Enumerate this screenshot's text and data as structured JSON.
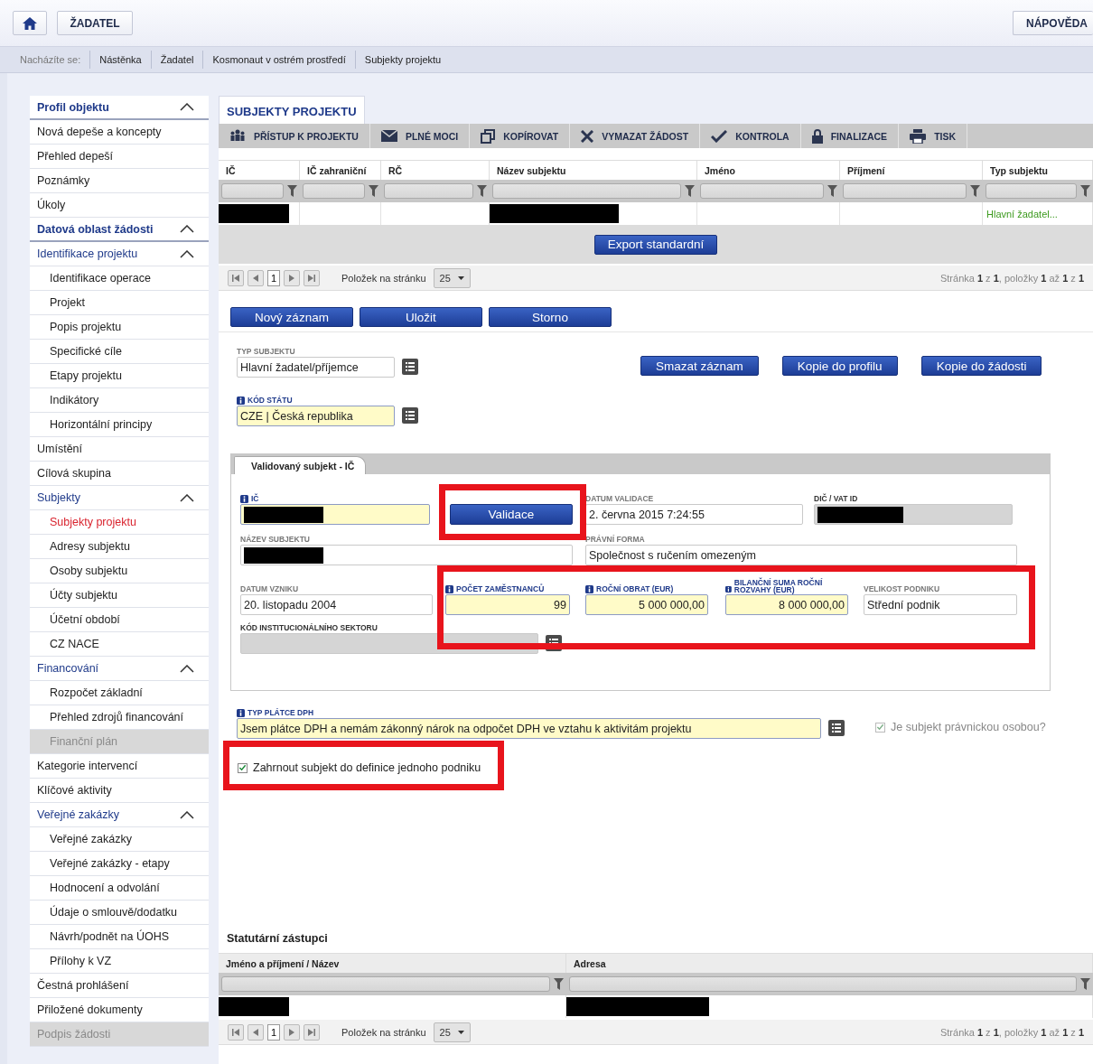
{
  "header": {
    "app_button": "ŽADATEL",
    "help_button": "NÁPOVĚDA"
  },
  "breadcrumb": {
    "prefix": "Nacházíte se:",
    "items": [
      "Nástěnka",
      "Žadatel",
      "Kosmonaut v ostrém prostředí",
      "Subjekty projektu"
    ]
  },
  "sidebar": {
    "items": [
      {
        "label": "Profil objektu",
        "kind": "section",
        "expanded": true,
        "selected": false,
        "disabled": false,
        "children": [
          {
            "label": "Nová depeše a koncepty",
            "kind": "item",
            "selected": false,
            "disabled": false
          },
          {
            "label": "Přehled depeší",
            "kind": "item",
            "selected": false,
            "disabled": false
          },
          {
            "label": "Poznámky",
            "kind": "item",
            "selected": false,
            "disabled": false
          },
          {
            "label": "Úkoly",
            "kind": "item",
            "selected": false,
            "disabled": false
          }
        ]
      },
      {
        "label": "Datová oblast žádosti",
        "kind": "section",
        "expanded": true,
        "selected": false,
        "disabled": false,
        "children": [
          {
            "label": "Identifikace projektu",
            "kind": "group",
            "expanded": true,
            "selected": false,
            "disabled": false,
            "children": [
              {
                "label": "Identifikace operace",
                "kind": "item",
                "selected": false,
                "disabled": false
              },
              {
                "label": "Projekt",
                "kind": "item",
                "selected": false,
                "disabled": false
              },
              {
                "label": "Popis projektu",
                "kind": "item",
                "selected": false,
                "disabled": false
              },
              {
                "label": "Specifické cíle",
                "kind": "item",
                "selected": false,
                "disabled": false
              },
              {
                "label": "Etapy projektu",
                "kind": "item",
                "selected": false,
                "disabled": false
              },
              {
                "label": "Indikátory",
                "kind": "item",
                "selected": false,
                "disabled": false
              },
              {
                "label": "Horizontální principy",
                "kind": "item",
                "selected": false,
                "disabled": false
              }
            ]
          },
          {
            "label": "Umístění",
            "kind": "item",
            "selected": false,
            "disabled": false
          },
          {
            "label": "Cílová skupina",
            "kind": "item",
            "selected": false,
            "disabled": false
          },
          {
            "label": "Subjekty",
            "kind": "group",
            "expanded": true,
            "selected": false,
            "disabled": false,
            "children": [
              {
                "label": "Subjekty projektu",
                "kind": "item",
                "selected": true,
                "disabled": false
              },
              {
                "label": "Adresy subjektu",
                "kind": "item",
                "selected": false,
                "disabled": false
              },
              {
                "label": "Osoby subjektu",
                "kind": "item",
                "selected": false,
                "disabled": false
              },
              {
                "label": "Účty subjektu",
                "kind": "item",
                "selected": false,
                "disabled": false
              },
              {
                "label": "Účetní období",
                "kind": "item",
                "selected": false,
                "disabled": false
              },
              {
                "label": "CZ NACE",
                "kind": "item",
                "selected": false,
                "disabled": false
              }
            ]
          },
          {
            "label": "Financování",
            "kind": "group",
            "expanded": true,
            "selected": false,
            "disabled": false,
            "children": [
              {
                "label": "Rozpočet základní",
                "kind": "item",
                "selected": false,
                "disabled": false
              },
              {
                "label": "Přehled zdrojů financování",
                "kind": "item",
                "selected": false,
                "disabled": false
              },
              {
                "label": "Finanční plán",
                "kind": "item",
                "selected": false,
                "disabled": true
              }
            ]
          },
          {
            "label": "Kategorie intervencí",
            "kind": "item",
            "selected": false,
            "disabled": false
          },
          {
            "label": "Klíčové aktivity",
            "kind": "item",
            "selected": false,
            "disabled": false
          },
          {
            "label": "Veřejné zakázky",
            "kind": "group",
            "expanded": true,
            "selected": false,
            "disabled": false,
            "children": [
              {
                "label": "Veřejné zakázky",
                "kind": "item",
                "selected": false,
                "disabled": false
              },
              {
                "label": "Veřejné zakázky - etapy",
                "kind": "item",
                "selected": false,
                "disabled": false
              },
              {
                "label": "Hodnocení a odvolání",
                "kind": "item",
                "selected": false,
                "disabled": false
              },
              {
                "label": "Údaje o smlouvě/dodatku",
                "kind": "item",
                "selected": false,
                "disabled": false
              },
              {
                "label": "Návrh/podnět na ÚOHS",
                "kind": "item",
                "selected": false,
                "disabled": false
              },
              {
                "label": "Přílohy k VZ",
                "kind": "item",
                "selected": false,
                "disabled": false
              }
            ]
          },
          {
            "label": "Čestná prohlášení",
            "kind": "item",
            "selected": false,
            "disabled": false
          },
          {
            "label": "Přiložené dokumenty",
            "kind": "item",
            "selected": false,
            "disabled": false
          },
          {
            "label": "Podpis žádosti",
            "kind": "item",
            "selected": false,
            "disabled": true
          }
        ]
      }
    ]
  },
  "tab": {
    "label": "SUBJEKTY PROJEKTU",
    "selected": true
  },
  "toolbar": [
    {
      "label": "PŘÍSTUP K PROJEKTU",
      "kind": "people"
    },
    {
      "label": "PLNÉ MOCI",
      "kind": "mail"
    },
    {
      "label": "KOPÍROVAT",
      "kind": "copy"
    },
    {
      "label": "VYMAZAT ŽÁDOST",
      "kind": "delete"
    },
    {
      "label": "KONTROLA",
      "kind": "check"
    },
    {
      "label": "FINALIZACE",
      "kind": "lock"
    },
    {
      "label": "TISK",
      "kind": "print"
    }
  ],
  "subjects_table": {
    "columns": [
      "IČ",
      "IČ zahraniční",
      "RČ",
      "Název subjektu",
      "Jméno",
      "Příjmení",
      "Typ subjektu"
    ],
    "rows": [
      {
        "cells": [
          {
            "kind": "redacted"
          },
          {
            "kind": "empty"
          },
          {
            "kind": "empty"
          },
          {
            "kind": "redacted"
          },
          {
            "kind": "empty"
          },
          {
            "kind": "empty"
          },
          {
            "kind": "text",
            "text": "Hlavní žadatel..."
          }
        ]
      }
    ],
    "export_button": "Export standardní",
    "pager": {
      "page": "1",
      "page_size_label": "Položek na stránku",
      "page_size": "25",
      "summary": "Stránka **1** z **1**, položky **1** až **1** z **1**"
    }
  },
  "form_buttons": [
    "Nový záznam",
    "Uložit",
    "Storno"
  ],
  "subject_type": {
    "label": "TYP SUBJEKTU",
    "value": "Hlavní žadatel/příjemce",
    "required": false,
    "info": false
  },
  "record_buttons": [
    "Smazat záznam",
    "Kopie do profilu",
    "Kopie do žádosti"
  ],
  "country": {
    "label": "KÓD STÁTU",
    "value": "CZE | Česká republika",
    "required": true,
    "info": true
  },
  "validated_panel": {
    "tab": {
      "label": "Validovaný subjekt - IČ",
      "selected": true
    },
    "fields": [
      {
        "kind": "field",
        "label": "IČ",
        "required": true,
        "readonly": false,
        "info": true,
        "redacted": true
      },
      {
        "kind": "button",
        "label": "Validace"
      },
      {
        "kind": "field",
        "label": "DATUM VALIDACE",
        "value": "2. června 2015 7:24:55",
        "required": false,
        "readonly": false,
        "info": false,
        "redacted": false
      },
      {
        "kind": "field",
        "label": "DIČ / VAT ID",
        "required": false,
        "readonly": true,
        "info": false,
        "redacted": true
      },
      {
        "kind": "field",
        "label": "NÁZEV SUBJEKTU",
        "required": false,
        "readonly": false,
        "info": false,
        "redacted": true
      },
      {
        "kind": "field",
        "label": "PRÁVNÍ FORMA",
        "value": "Společnost s ručením omezeným",
        "required": false,
        "readonly": false,
        "info": false,
        "redacted": false
      },
      {
        "kind": "field",
        "label": "DATUM VZNIKU",
        "value": "20. listopadu 2004",
        "required": false,
        "readonly": false,
        "info": false,
        "redacted": false
      },
      {
        "kind": "number",
        "label": "POČET ZAMĚSTNANCŮ",
        "value": "99",
        "required": true,
        "readonly": false,
        "info": true,
        "redacted": false
      },
      {
        "kind": "number",
        "label": "ROČNÍ OBRAT (EUR)",
        "value": "5 000 000,00",
        "required": true,
        "readonly": false,
        "info": true,
        "redacted": false
      },
      {
        "kind": "number",
        "label": "BILANČNÍ SUMA ROČNÍ ROZVAHY (EUR)",
        "value": "8 000 000,00",
        "required": true,
        "readonly": false,
        "info": true,
        "redacted": false
      },
      {
        "kind": "field",
        "label": "VELIKOST PODNIKU",
        "value": "Střední podnik",
        "required": false,
        "readonly": false,
        "info": false,
        "redacted": false
      },
      {
        "kind": "picker",
        "label": "KÓD INSTITUCIONÁLNÍHO SEKTORU",
        "required": false,
        "readonly": true,
        "info": false,
        "redacted": false
      }
    ]
  },
  "vat_payer": {
    "label": "TYP PLÁTCE DPH",
    "value": "Jsem plátce DPH a nemám zákonný nárok na odpočet DPH ve vztahu k aktivitám projektu",
    "required": true,
    "info": true
  },
  "legal_person": {
    "label": "Je subjekt právnickou osobou?",
    "checked": true,
    "disabled": true
  },
  "single_enterprise": {
    "label": "Zahrnout subjekt do definice jednoho podniku",
    "checked": true,
    "disabled": false
  },
  "representatives": {
    "title": "Statutární zástupci",
    "columns": [
      "Jméno a příjmení / Název",
      "Adresa"
    ],
    "rows": [
      {
        "cells": [
          {
            "kind": "redacted"
          },
          {
            "kind": "redacted"
          }
        ]
      }
    ],
    "pager": {
      "page": "1",
      "page_size_label": "Položek na stránku",
      "page_size": "25",
      "summary": "Stránka **1** z **1**, položky **1** až **1** z **1**"
    }
  }
}
